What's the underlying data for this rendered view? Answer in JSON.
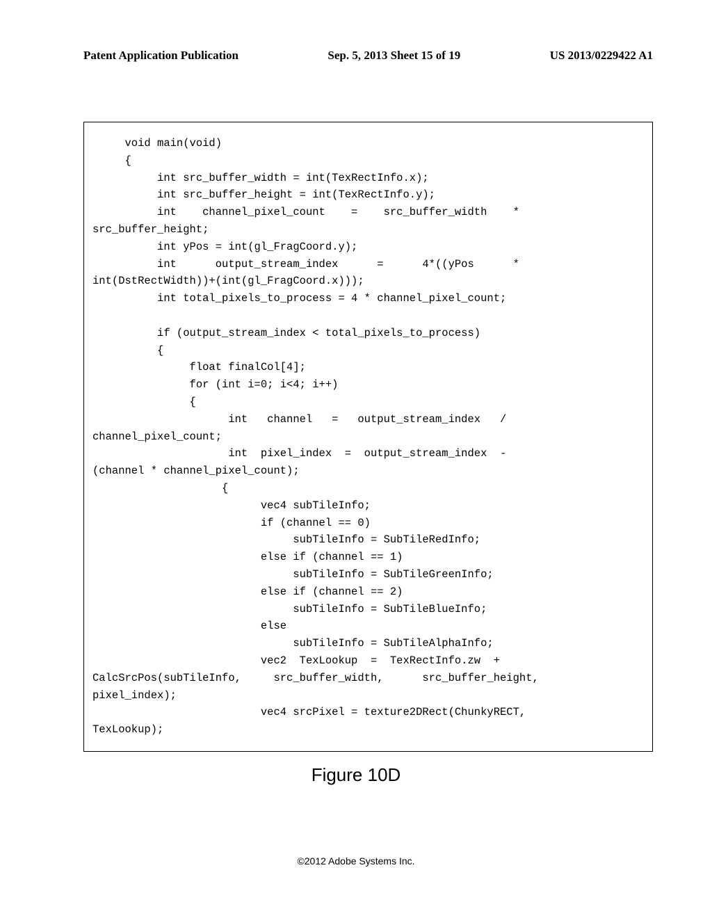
{
  "header": {
    "left": "Patent Application Publication",
    "center": "Sep. 5, 2013  Sheet 15 of 19",
    "right": "US 2013/0229422 A1"
  },
  "code": "     void main(void)\n     {\n          int src_buffer_width = int(TexRectInfo.x);\n          int src_buffer_height = int(TexRectInfo.y);\n          int    channel_pixel_count    =    src_buffer_width    *\nsrc_buffer_height;\n          int yPos = int(gl_FragCoord.y);\n          int      output_stream_index      =      4*((yPos      *\nint(DstRectWidth))+(int(gl_FragCoord.x)));\n          int total_pixels_to_process = 4 * channel_pixel_count;\n\n          if (output_stream_index < total_pixels_to_process)\n          {\n               float finalCol[4];\n               for (int i=0; i<4; i++)\n               {\n                     int   channel   =   output_stream_index   /\nchannel_pixel_count;\n                     int  pixel_index  =  output_stream_index  -\n(channel * channel_pixel_count);\n                    {\n                          vec4 subTileInfo;\n                          if (channel == 0)\n                               subTileInfo = SubTileRedInfo;\n                          else if (channel == 1)\n                               subTileInfo = SubTileGreenInfo;\n                          else if (channel == 2)\n                               subTileInfo = SubTileBlueInfo;\n                          else\n                               subTileInfo = SubTileAlphaInfo;\n                          vec2  TexLookup  =  TexRectInfo.zw  +\nCalcSrcPos(subTileInfo,     src_buffer_width,      src_buffer_height,\npixel_index);\n                          vec4 srcPixel = texture2DRect(ChunkyRECT,\nTexLookup);",
  "figure_caption": "Figure 10D",
  "copyright": "©2012 Adobe Systems Inc."
}
